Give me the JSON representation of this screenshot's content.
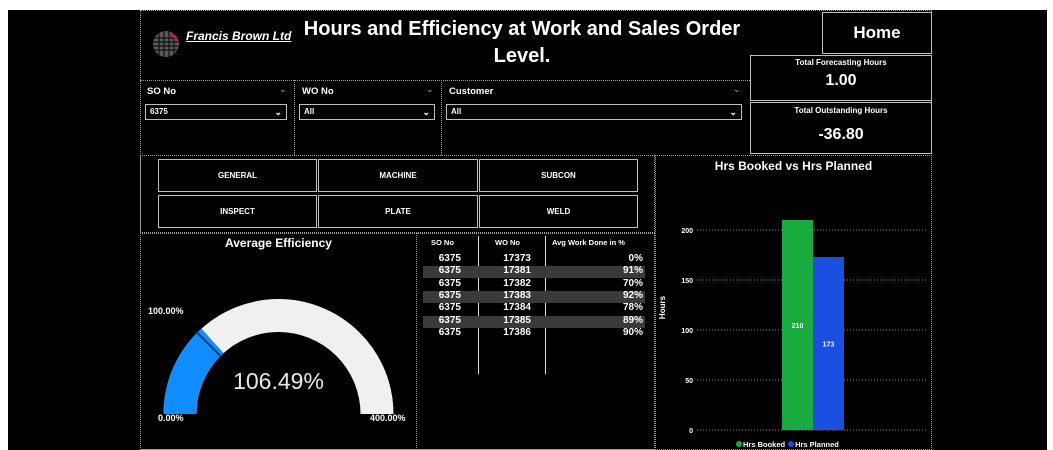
{
  "header": {
    "brand": "Francis Brown Ltd",
    "title": "Hours and Efficiency at Work and Sales Order Level.",
    "home_label": "Home"
  },
  "kpis": {
    "forecast_label": "Total Forecasting Hours",
    "forecast_value": "1.00",
    "outstanding_label": "Total Outstanding Hours",
    "outstanding_value": "-36.80"
  },
  "filters": {
    "so": {
      "label": "SO No",
      "value": "6375"
    },
    "wo": {
      "label": "WO No",
      "value": "All"
    },
    "customer": {
      "label": "Customer",
      "value": "All"
    }
  },
  "category_buttons": [
    "GENERAL",
    "MACHINE",
    "SUBCON",
    "INSPECT",
    "PLATE",
    "WELD"
  ],
  "gauge": {
    "title": "Average Efficiency",
    "value_text": "106.49%",
    "value": 106.49,
    "min": 0,
    "max": 400,
    "min_label": "0.00%",
    "max_label": "400.00%",
    "target_label": "100.00%",
    "fill_color": "#118dff",
    "track_color": "#f0f0f0"
  },
  "table": {
    "headers": [
      "SO No",
      "WO No",
      "Avg Work Done in %"
    ],
    "rows": [
      [
        "6375",
        "17373",
        "0%"
      ],
      [
        "6375",
        "17381",
        "91%"
      ],
      [
        "6375",
        "17382",
        "70%"
      ],
      [
        "6375",
        "17383",
        "92%"
      ],
      [
        "6375",
        "17384",
        "78%"
      ],
      [
        "6375",
        "17385",
        "89%"
      ],
      [
        "6375",
        "17386",
        "90%"
      ]
    ]
  },
  "chart_data": {
    "type": "bar",
    "title": "Hrs Booked vs Hrs Planned",
    "ylabel": "Hours",
    "yticks": [
      0,
      50,
      100,
      150,
      200
    ],
    "ylim": [
      0,
      220
    ],
    "grid": true,
    "legend": "bottom",
    "series": [
      {
        "name": "Hrs Booked",
        "value": 210,
        "label": "210",
        "color": "#1aab40"
      },
      {
        "name": "Hrs Planned",
        "value": 173,
        "label": "173",
        "color": "#1a4fe0"
      }
    ]
  }
}
